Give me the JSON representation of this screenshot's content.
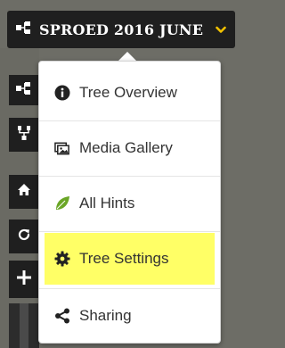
{
  "header": {
    "tree_title": "SPROED 2016 JUNE"
  },
  "menu": {
    "items": [
      {
        "label": "Tree Overview",
        "icon": "info-circle-icon"
      },
      {
        "label": "Media Gallery",
        "icon": "photos-icon"
      },
      {
        "label": "All Hints",
        "icon": "leaf-icon"
      },
      {
        "label": "Tree Settings",
        "icon": "gear-icon",
        "highlighted": true
      },
      {
        "label": "Sharing",
        "icon": "share-icon"
      }
    ]
  },
  "colors": {
    "highlight": "#ffff66",
    "leaf_green": "#6aa626",
    "toolbar_dark": "#1f1f1f",
    "chevron_yellow": "#f2c200"
  }
}
